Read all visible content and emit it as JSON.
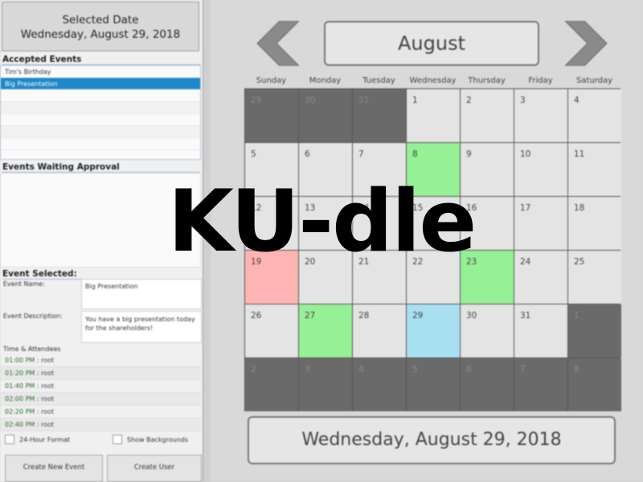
{
  "overlay_title": "KU-dle",
  "selected_date_panel": {
    "heading": "Selected Date",
    "date": "Wednesday, August 29, 2018"
  },
  "accepted_events": {
    "title": "Accepted Events",
    "items": [
      "Tim's Birthday",
      "Big Presentation"
    ],
    "selected_index": 1
  },
  "waiting_events": {
    "title": "Events Waiting Approval",
    "items": []
  },
  "event_selected": {
    "title": "Event Selected:",
    "name_label": "Event Name:",
    "name_value": "Big Presentation",
    "description_label": "Event Description:",
    "description_value": "You have a big presentation today\nfor the shareholders!",
    "time_attendees_label": "Time & Attendees",
    "times": [
      {
        "time": "01:00 PM",
        "attendee": " : root"
      },
      {
        "time": "01:20 PM",
        "attendee": " : root"
      },
      {
        "time": "01:40 PM",
        "attendee": " : root"
      },
      {
        "time": "02:00 PM",
        "attendee": " : root"
      },
      {
        "time": "02:20 PM",
        "attendee": " : root"
      },
      {
        "time": "02:40 PM",
        "attendee": " : root"
      }
    ]
  },
  "options": {
    "hour24_label": "24-Hour Format",
    "backgrounds_label": "Show Backgrounds"
  },
  "buttons": {
    "create_event": "Create New Event",
    "create_user": "Create User"
  },
  "calendar": {
    "month": "August",
    "day_names": [
      "Sunday",
      "Monday",
      "Tuesday",
      "Wednesday",
      "Thursday",
      "Friday",
      "Saturday"
    ],
    "weeks": [
      [
        {
          "d": "29",
          "t": "other"
        },
        {
          "d": "30",
          "t": "other"
        },
        {
          "d": "31",
          "t": "other"
        },
        {
          "d": "1",
          "t": "cur"
        },
        {
          "d": "2",
          "t": "cur"
        },
        {
          "d": "3",
          "t": "cur"
        },
        {
          "d": "4",
          "t": "cur"
        }
      ],
      [
        {
          "d": "5",
          "t": "cur"
        },
        {
          "d": "6",
          "t": "cur"
        },
        {
          "d": "7",
          "t": "cur"
        },
        {
          "d": "8",
          "t": "green"
        },
        {
          "d": "9",
          "t": "cur"
        },
        {
          "d": "10",
          "t": "cur"
        },
        {
          "d": "11",
          "t": "cur"
        }
      ],
      [
        {
          "d": "12",
          "t": "cur"
        },
        {
          "d": "13",
          "t": "cur"
        },
        {
          "d": "14",
          "t": "cur"
        },
        {
          "d": "15",
          "t": "cur"
        },
        {
          "d": "16",
          "t": "cur"
        },
        {
          "d": "17",
          "t": "cur"
        },
        {
          "d": "18",
          "t": "cur"
        }
      ],
      [
        {
          "d": "19",
          "t": "pink"
        },
        {
          "d": "20",
          "t": "cur"
        },
        {
          "d": "21",
          "t": "cur"
        },
        {
          "d": "22",
          "t": "cur"
        },
        {
          "d": "23",
          "t": "green"
        },
        {
          "d": "24",
          "t": "cur"
        },
        {
          "d": "25",
          "t": "cur"
        }
      ],
      [
        {
          "d": "26",
          "t": "cur"
        },
        {
          "d": "27",
          "t": "green"
        },
        {
          "d": "28",
          "t": "cur"
        },
        {
          "d": "29",
          "t": "blue"
        },
        {
          "d": "30",
          "t": "cur"
        },
        {
          "d": "31",
          "t": "cur"
        },
        {
          "d": "1",
          "t": "other"
        }
      ],
      [
        {
          "d": "2",
          "t": "other"
        },
        {
          "d": "3",
          "t": "other"
        },
        {
          "d": "4",
          "t": "other"
        },
        {
          "d": "5",
          "t": "other"
        },
        {
          "d": "6",
          "t": "other"
        },
        {
          "d": "7",
          "t": "other"
        },
        {
          "d": "8",
          "t": "other"
        }
      ]
    ],
    "selected_date_display": "Wednesday, August 29, 2018"
  },
  "icons": {
    "prev": "chevron-left-icon",
    "next": "chevron-right-icon"
  }
}
